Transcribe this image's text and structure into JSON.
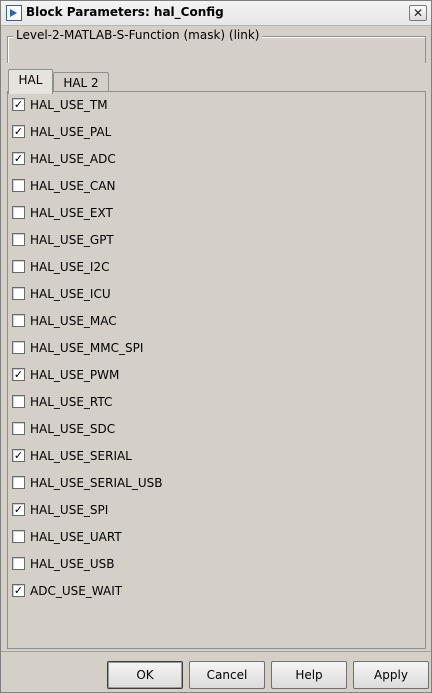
{
  "window": {
    "title": "Block Parameters: hal_Config",
    "close_glyph": "✕"
  },
  "mask": {
    "label": "Level-2-MATLAB-S-Function (mask) (link)"
  },
  "tabs": [
    {
      "label": "HAL",
      "active": true
    },
    {
      "label": "HAL 2",
      "active": false
    }
  ],
  "checkboxes": [
    {
      "label": "HAL_USE_TM",
      "checked": true
    },
    {
      "label": "HAL_USE_PAL",
      "checked": true
    },
    {
      "label": "HAL_USE_ADC",
      "checked": true
    },
    {
      "label": "HAL_USE_CAN",
      "checked": false
    },
    {
      "label": "HAL_USE_EXT",
      "checked": false
    },
    {
      "label": "HAL_USE_GPT",
      "checked": false
    },
    {
      "label": "HAL_USE_I2C",
      "checked": false
    },
    {
      "label": "HAL_USE_ICU",
      "checked": false
    },
    {
      "label": "HAL_USE_MAC",
      "checked": false
    },
    {
      "label": "HAL_USE_MMC_SPI",
      "checked": false
    },
    {
      "label": "HAL_USE_PWM",
      "checked": true
    },
    {
      "label": "HAL_USE_RTC",
      "checked": false
    },
    {
      "label": "HAL_USE_SDC",
      "checked": false
    },
    {
      "label": "HAL_USE_SERIAL",
      "checked": true
    },
    {
      "label": "HAL_USE_SERIAL_USB",
      "checked": false
    },
    {
      "label": "HAL_USE_SPI",
      "checked": true
    },
    {
      "label": "HAL_USE_UART",
      "checked": false
    },
    {
      "label": "HAL_USE_USB",
      "checked": false
    },
    {
      "label": "ADC_USE_WAIT",
      "checked": true
    }
  ],
  "check_glyph": "✓",
  "buttons": {
    "ok": "OK",
    "cancel": "Cancel",
    "help": "Help",
    "apply": "Apply"
  }
}
